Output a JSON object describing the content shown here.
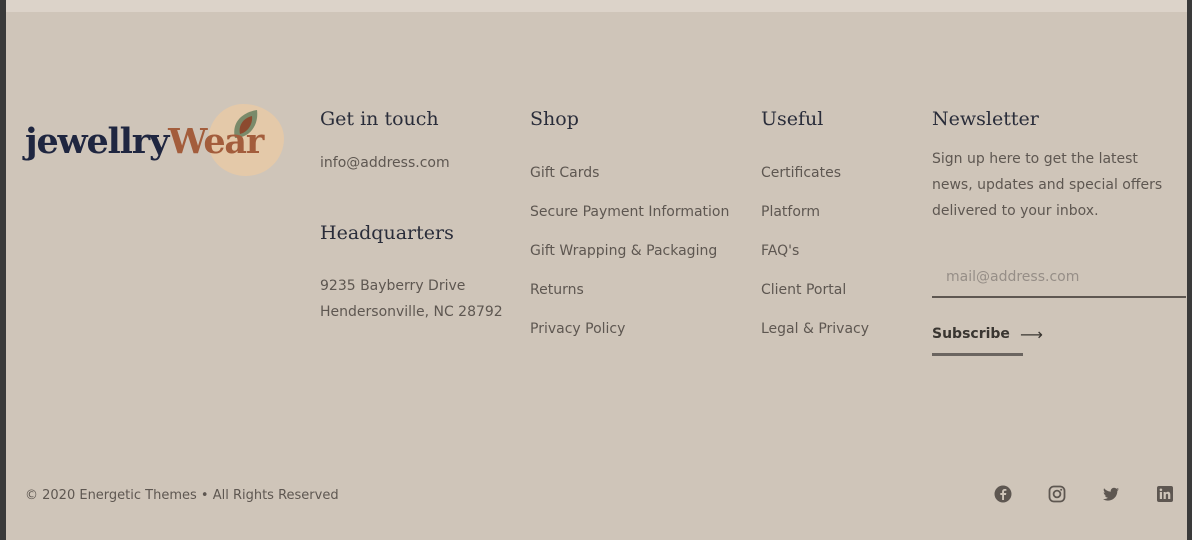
{
  "brand": {
    "logo_part1": "jewellry",
    "logo_part2": "Wear",
    "colors": {
      "dark": "#1f2640",
      "rust": "#a35d3c",
      "blob": "#e8c9a6",
      "leaf": "#7a8a6a",
      "background": "#cfc5b9"
    }
  },
  "contact": {
    "heading": "Get in touch",
    "email": "info@address.com",
    "hq_heading": "Headquarters",
    "address_line1": "9235 Bayberry Drive",
    "address_line2": "Hendersonville, NC 28792"
  },
  "shop": {
    "heading": "Shop",
    "items": [
      "Gift Cards",
      "Secure Payment Information",
      "Gift Wrapping & Packaging",
      "Returns",
      "Privacy Policy"
    ]
  },
  "useful": {
    "heading": "Useful",
    "items": [
      "Certificates",
      "Platform",
      "FAQ's",
      "Client Portal",
      "Legal & Privacy"
    ]
  },
  "newsletter": {
    "heading": "Newsletter",
    "description": "Sign up here to get the latest news, updates and special offers delivered to your inbox.",
    "email_placeholder": "mail@address.com",
    "email_value": "",
    "subscribe_label": "Subscribe",
    "subscribe_arrow": "⟶"
  },
  "footer": {
    "copyright": "© 2020 Energetic Themes • All Rights Reserved",
    "social_icons": [
      "facebook-icon",
      "instagram-icon",
      "twitter-icon",
      "linkedin-icon"
    ]
  }
}
